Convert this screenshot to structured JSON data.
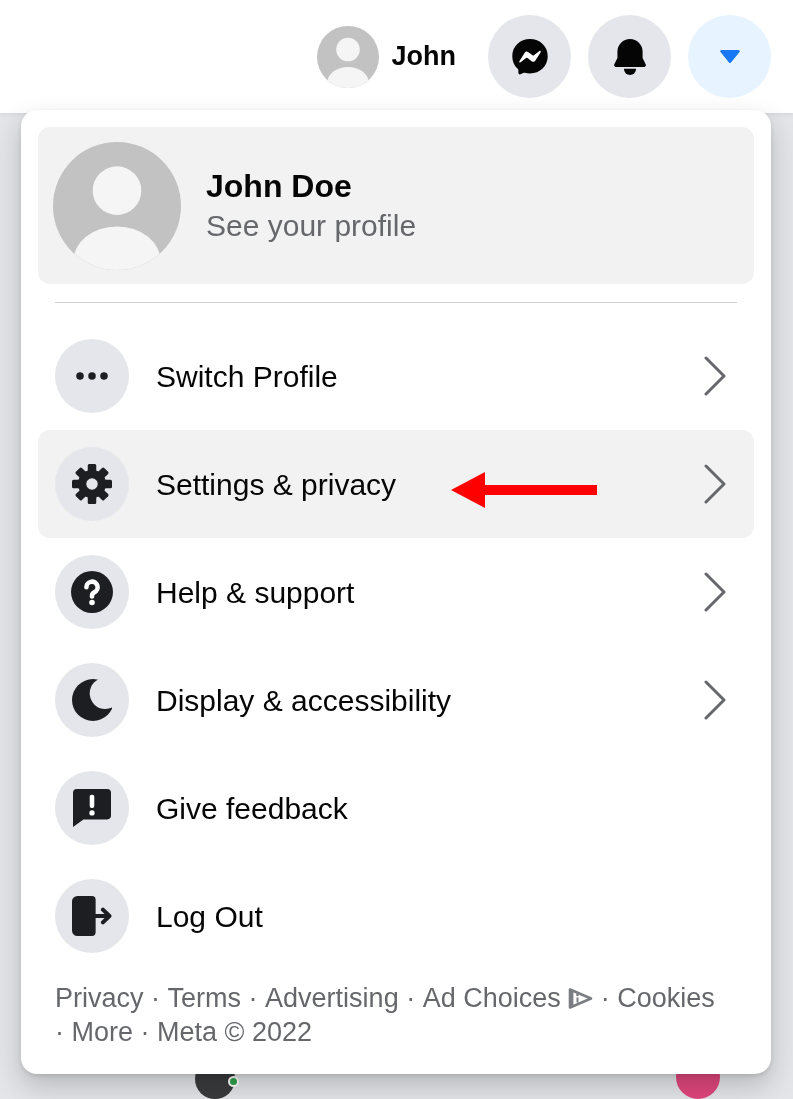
{
  "top_bar": {
    "profile_name": "John",
    "buttons": [
      {
        "kind": "chat",
        "selected": false
      },
      {
        "kind": "notifications",
        "selected": false
      },
      {
        "kind": "account",
        "selected": true
      }
    ]
  },
  "menu": {
    "profile": {
      "name": "John Doe",
      "subtitle": "See your profile"
    },
    "items": [
      {
        "kind": "switch",
        "label": "Switch Profile",
        "submenu": true,
        "selected": false,
        "annotation_arrow": false
      },
      {
        "kind": "settings",
        "label": "Settings & privacy",
        "submenu": true,
        "selected": true,
        "annotation_arrow": true
      },
      {
        "kind": "help",
        "label": "Help & support",
        "submenu": true,
        "selected": false,
        "annotation_arrow": false
      },
      {
        "kind": "display",
        "label": "Display & accessibility",
        "submenu": true,
        "selected": false,
        "annotation_arrow": false
      },
      {
        "kind": "feedback",
        "label": "Give feedback",
        "submenu": false,
        "selected": false,
        "annotation_arrow": false
      },
      {
        "kind": "logout",
        "label": "Log Out",
        "submenu": false,
        "selected": false,
        "annotation_arrow": false
      }
    ],
    "footer": {
      "links": [
        {
          "label": "Privacy",
          "adchoices_icon": false
        },
        {
          "label": "Terms",
          "adchoices_icon": false
        },
        {
          "label": "Advertising",
          "adchoices_icon": false
        },
        {
          "label": "Ad Choices",
          "adchoices_icon": true
        },
        {
          "label": "Cookies",
          "adchoices_icon": false
        },
        {
          "label": "More",
          "adchoices_icon": false
        }
      ],
      "separator": "·",
      "copyright": "Meta © 2022"
    }
  },
  "page_behind": {
    "contact_online": true
  }
}
